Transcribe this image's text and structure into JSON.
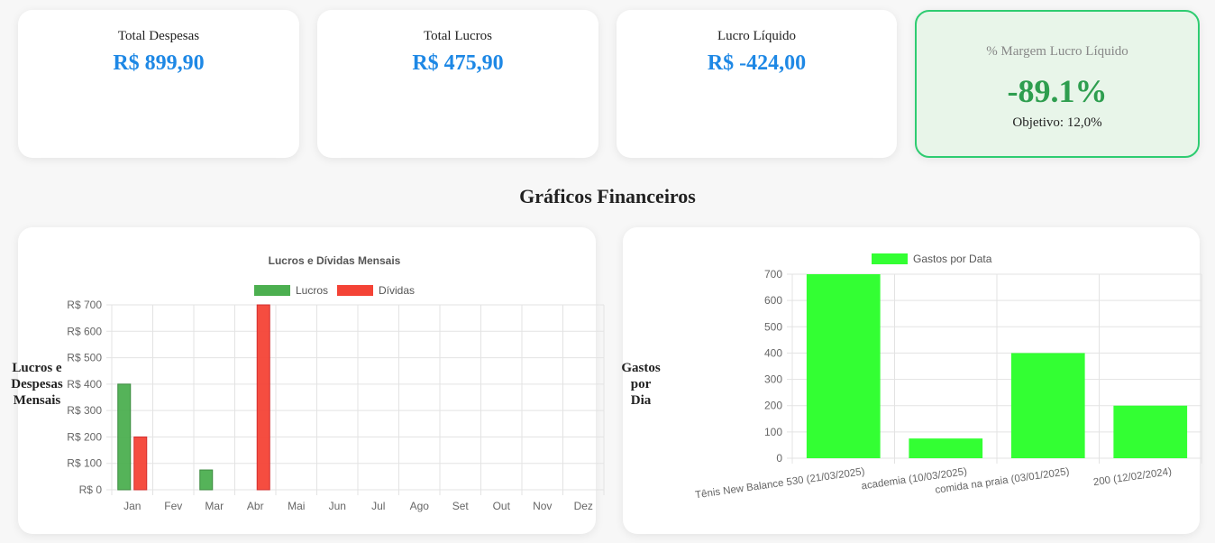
{
  "cards": {
    "despesas": {
      "label": "Total Despesas",
      "value": "R$ 899,90"
    },
    "lucros": {
      "label": "Total Lucros",
      "value": "R$ 475,90"
    },
    "liquido": {
      "label": "Lucro Líquido",
      "value": "R$ -424,00"
    },
    "margem": {
      "label": "% Margem Lucro Líquido",
      "value": "-89.1%",
      "goal": "Objetivo: 12,0%"
    }
  },
  "section_title": "Gráficos Financeiros",
  "colors": {
    "lucros": "#4caf50",
    "dividas": "#f44336",
    "gastos": "#33ff33",
    "accent": "#1e88e5",
    "margin": "#2e9e4f"
  },
  "chart_data": [
    {
      "type": "bar",
      "title": "Lucros e Dívidas Mensais",
      "side_label": [
        "Lucros e",
        "Despesas",
        "Mensais"
      ],
      "categories": [
        "Jan",
        "Fev",
        "Mar",
        "Abr",
        "Mai",
        "Jun",
        "Jul",
        "Ago",
        "Set",
        "Out",
        "Nov",
        "Dez"
      ],
      "series": [
        {
          "name": "Lucros",
          "values": [
            400,
            0,
            75,
            0,
            0,
            0,
            0,
            0,
            0,
            0,
            0,
            0
          ]
        },
        {
          "name": "Dívidas",
          "values": [
            200,
            0,
            0,
            700,
            0,
            0,
            0,
            0,
            0,
            0,
            0,
            0
          ]
        }
      ],
      "ylim": [
        0,
        700
      ],
      "yticks": [
        "R$ 0",
        "R$ 100",
        "R$ 200",
        "R$ 300",
        "R$ 400",
        "R$ 500",
        "R$ 600",
        "R$ 700"
      ],
      "legend": "top",
      "grid": true
    },
    {
      "type": "bar",
      "title": "",
      "side_label": [
        "Gastos",
        "por",
        "Dia"
      ],
      "categories": [
        "Tênis New Balance 530 (21/03/2025)",
        "academia (10/03/2025)",
        "comida na praia (03/01/2025)",
        "200 (12/02/2024)"
      ],
      "series": [
        {
          "name": "Gastos por Data",
          "values": [
            700,
            75,
            400,
            200
          ]
        }
      ],
      "ylim": [
        0,
        700
      ],
      "yticks": [
        "0",
        "100",
        "200",
        "300",
        "400",
        "500",
        "600",
        "700"
      ],
      "legend": "top",
      "grid": true
    }
  ]
}
